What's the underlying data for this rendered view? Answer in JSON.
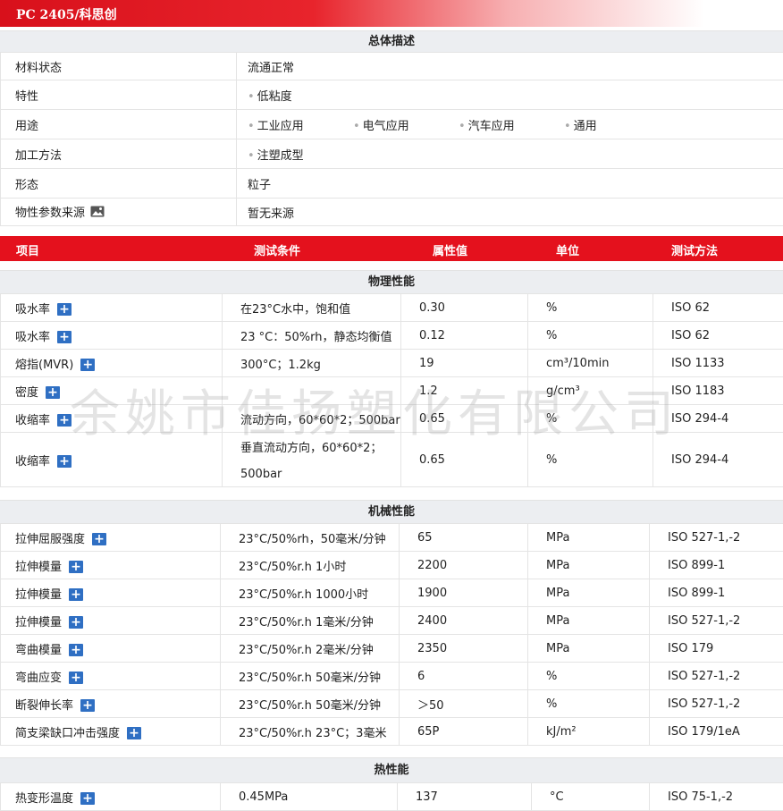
{
  "title": "PC 2405/科思创",
  "overview": {
    "heading": "总体描述",
    "rows": [
      {
        "label": "材料状态",
        "values": [
          "流通正常"
        ],
        "bullets": false
      },
      {
        "label": "特性",
        "values": [
          "低粘度"
        ],
        "bullets": true
      },
      {
        "label": "用途",
        "values": [
          "工业应用",
          "电气应用",
          "汽车应用",
          "通用"
        ],
        "bullets": true
      },
      {
        "label": "加工方法",
        "values": [
          "注塑成型"
        ],
        "bullets": true
      },
      {
        "label": "形态",
        "values": [
          "粒子"
        ],
        "bullets": false
      },
      {
        "label": "物性参数来源",
        "values": [
          "暂无来源"
        ],
        "bullets": false,
        "icon": "image-icon"
      }
    ]
  },
  "table_header": {
    "item": "项目",
    "condition": "测试条件",
    "value": "属性值",
    "unit": "单位",
    "method": "测试方法"
  },
  "physical": {
    "heading": "物理性能",
    "rows": [
      {
        "item": "吸水率",
        "condition": "在23°C水中，饱和值",
        "value": "0.30",
        "unit": "%",
        "method": "ISO 62"
      },
      {
        "item": "吸水率",
        "condition": "23 °C：50%rh，静态均衡值",
        "value": "0.12",
        "unit": "%",
        "method": "ISO 62"
      },
      {
        "item": "熔指(MVR)",
        "condition": "300°C；1.2kg",
        "value": "19",
        "unit": "cm³/10min",
        "method": "ISO 1133"
      },
      {
        "item": "密度",
        "condition": "",
        "value": "1.2",
        "unit": "g/cm³",
        "method": "ISO 1183"
      },
      {
        "item": "收缩率",
        "condition": "流动方向，60*60*2；500bar",
        "value": "0.65",
        "unit": "%",
        "method": "ISO 294-4"
      },
      {
        "item": "收缩率",
        "condition": "垂直流动方向，60*60*2；",
        "condition2": "500bar",
        "value": "0.65",
        "unit": "%",
        "method": "ISO 294-4"
      }
    ]
  },
  "mechanical": {
    "heading": "机械性能",
    "rows": [
      {
        "item": "拉伸屈服强度",
        "condition": "23°C/50%rh，50毫米/分钟",
        "value": "65",
        "unit": "MPa",
        "method": "ISO 527-1,-2"
      },
      {
        "item": "拉伸模量",
        "condition": "23°C/50%r.h  1小时",
        "value": "2200",
        "unit": "MPa",
        "method": "ISO 899-1"
      },
      {
        "item": "拉伸模量",
        "condition": "23°C/50%r.h  1000小时",
        "value": "1900",
        "unit": "MPa",
        "method": "ISO 899-1"
      },
      {
        "item": "拉伸模量",
        "condition": "23°C/50%r.h 1毫米/分钟",
        "value": "2400",
        "unit": "MPa",
        "method": "ISO 527-1,-2"
      },
      {
        "item": "弯曲模量",
        "condition": "23°C/50%r.h  2毫米/分钟",
        "value": "2350",
        "unit": "MPa",
        "method": "ISO 179"
      },
      {
        "item": "弯曲应变",
        "condition": "23°C/50%r.h 50毫米/分钟",
        "value": "6",
        "unit": "%",
        "method": "ISO 527-1,-2"
      },
      {
        "item": "断裂伸长率",
        "condition": "23°C/50%r.h 50毫米/分钟",
        "value": "＞50",
        "unit": "%",
        "method": "ISO 527-1,-2"
      },
      {
        "item": "简支梁缺口冲击强度",
        "condition": "23°C/50%r.h 23°C；3毫米",
        "value": "65P",
        "unit": "kJ/m²",
        "method": "ISO 179/1eA"
      }
    ]
  },
  "thermal": {
    "heading": "热性能",
    "rows": [
      {
        "item": "热变形温度",
        "condition": "0.45MPa",
        "value": "137",
        "unit": "°C",
        "method": "ISO 75-1,-2"
      }
    ]
  },
  "watermark": "余姚市佳扬塑化有限公司",
  "colors": {
    "accent": "#e4111d",
    "plus_icon": "#2f6fc3",
    "section_bg": "#eceef1"
  }
}
